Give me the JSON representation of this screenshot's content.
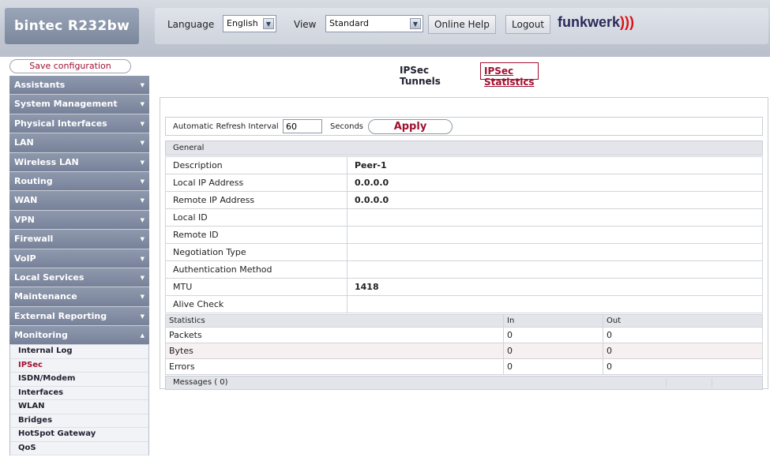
{
  "header": {
    "brand": "bintec  R232bw",
    "language_label": "Language",
    "language_value": "English",
    "view_label": "View",
    "view_value": "Standard",
    "online_help": "Online Help",
    "logout": "Logout",
    "logo": "funkwerk",
    "logo_mark": ")))"
  },
  "sidebar": {
    "save": "Save configuration",
    "menu": [
      {
        "label": "Assistants",
        "caret": "▼"
      },
      {
        "label": "System Management",
        "caret": "▼"
      },
      {
        "label": "Physical Interfaces",
        "caret": "▼"
      },
      {
        "label": "LAN",
        "caret": "▼"
      },
      {
        "label": "Wireless LAN",
        "caret": "▼"
      },
      {
        "label": "Routing",
        "caret": "▼"
      },
      {
        "label": "WAN",
        "caret": "▼"
      },
      {
        "label": "VPN",
        "caret": "▼"
      },
      {
        "label": "Firewall",
        "caret": "▼"
      },
      {
        "label": "VoIP",
        "caret": "▼"
      },
      {
        "label": "Local Services",
        "caret": "▼"
      },
      {
        "label": "Maintenance",
        "caret": "▼"
      },
      {
        "label": "External Reporting",
        "caret": "▼"
      },
      {
        "label": "Monitoring",
        "caret": "▲"
      }
    ],
    "submenu": [
      "Internal Log",
      "IPSec",
      "ISDN/Modem",
      "Interfaces",
      "WLAN",
      "Bridges",
      "HotSpot Gateway",
      "QoS"
    ]
  },
  "tabs": {
    "tunnels": "IPSec Tunnels",
    "statistics": "IPSec Statistics"
  },
  "refresh": {
    "label": "Automatic Refresh Interval",
    "value": "60",
    "unit": "Seconds",
    "apply": "Apply"
  },
  "general": {
    "header": "General",
    "rows": [
      {
        "key": "Description",
        "value": "Peer-1"
      },
      {
        "key": "Local IP Address",
        "value": "0.0.0.0"
      },
      {
        "key": "Remote IP Address",
        "value": "0.0.0.0"
      },
      {
        "key": "Local ID",
        "value": ""
      },
      {
        "key": "Remote ID",
        "value": ""
      },
      {
        "key": "Negotiation Type",
        "value": ""
      },
      {
        "key": "Authentication Method",
        "value": ""
      },
      {
        "key": "MTU",
        "value": "1418"
      },
      {
        "key": "Alive Check",
        "value": ""
      }
    ]
  },
  "statistics": {
    "header": "Statistics",
    "col_in": "In",
    "col_out": "Out",
    "rows": [
      {
        "label": "Packets",
        "in": "0",
        "out": "0"
      },
      {
        "label": "Bytes",
        "in": "0",
        "out": "0"
      },
      {
        "label": "Errors",
        "in": "0",
        "out": "0"
      }
    ]
  },
  "messages": "Messages  ( 0)"
}
